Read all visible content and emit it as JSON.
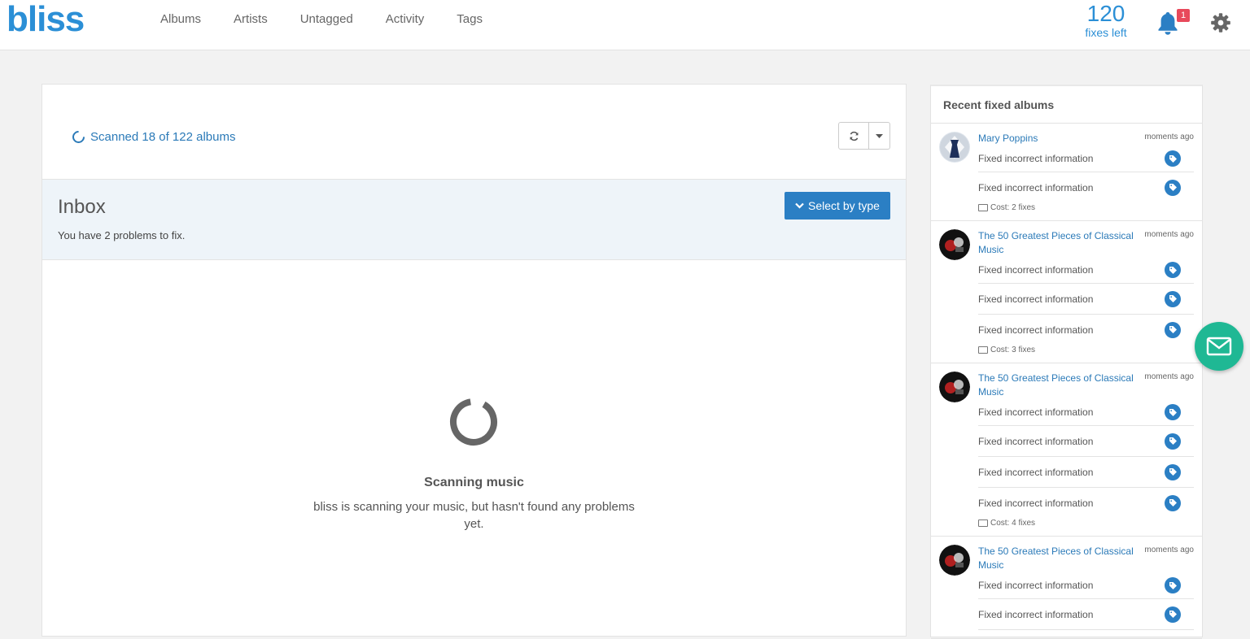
{
  "brand": {
    "logo": "bliss",
    "color": "#2b8fd6"
  },
  "nav": [
    "Albums",
    "Artists",
    "Untagged",
    "Activity",
    "Tags"
  ],
  "fixes": {
    "count": "120",
    "label": "fixes left"
  },
  "notifications": {
    "badge": "1"
  },
  "scan": {
    "status": "Scanned 18 of 122 albums"
  },
  "inbox": {
    "title": "Inbox",
    "subtitle": "You have 2 problems to fix.",
    "select_label": "Select by type"
  },
  "empty_state": {
    "title": "Scanning music",
    "description": "bliss is scanning your music, but hasn't found any problems yet."
  },
  "sidebar": {
    "title": "Recent fixed albums",
    "albums": [
      {
        "name": "Mary Poppins",
        "time": "moments ago",
        "fixes": [
          "Fixed incorrect information",
          "Fixed incorrect information"
        ],
        "cost": "Cost: 2 fixes"
      },
      {
        "name": "The 50 Greatest Pieces of Classical Music",
        "time": "moments ago",
        "fixes": [
          "Fixed incorrect information",
          "Fixed incorrect information",
          "Fixed incorrect information"
        ],
        "cost": "Cost: 3 fixes"
      },
      {
        "name": "The 50 Greatest Pieces of Classical Music",
        "time": "moments ago",
        "fixes": [
          "Fixed incorrect information",
          "Fixed incorrect information",
          "Fixed incorrect information",
          "Fixed incorrect information"
        ],
        "cost": "Cost: 4 fixes"
      },
      {
        "name": "The 50 Greatest Pieces of Classical Music",
        "time": "moments ago",
        "fixes": [
          "Fixed incorrect information",
          "Fixed incorrect information"
        ],
        "cost": ""
      }
    ]
  },
  "colors": {
    "accent": "#2b7fc4",
    "mail_fab": "#1fb894",
    "badge": "#e8495b"
  }
}
